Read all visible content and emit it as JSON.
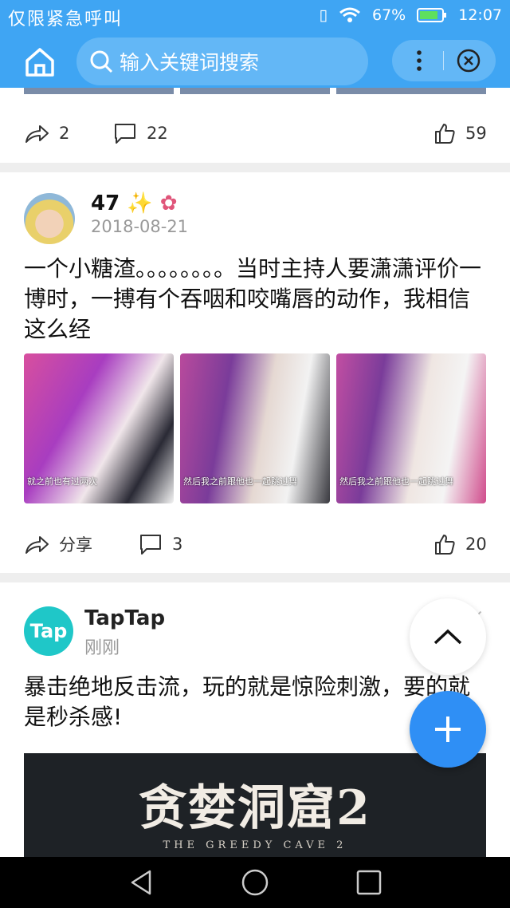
{
  "status_bar": {
    "carrier": "仅限紧急呼叫",
    "battery": "67%",
    "time": "12:07"
  },
  "header": {
    "search_placeholder": "输入关键词搜索"
  },
  "post1": {
    "share_count": "2",
    "comment_count": "22",
    "like_count": "59"
  },
  "post2": {
    "author": "47",
    "date": "2018-08-21",
    "text": "一个小糖渣。。。。。。。。当时主持人要潇潇评价一博时，一搏有个吞咽和咬嘴唇的动作，我相信这么经",
    "images": [
      {
        "caption": "就之前也有过两次"
      },
      {
        "caption": "然后我之前跟他也一起跳过舞"
      },
      {
        "caption": "然后我之前跟他也一起跳过舞"
      }
    ],
    "share_label": "分享",
    "comment_count": "3",
    "like_count": "20"
  },
  "ad": {
    "logo_text": "Tap",
    "name": "TapTap",
    "time": "刚刚",
    "text": "暴击绝地反击流，玩的就是惊险刺激，要的就是秒杀感!",
    "banner_title": "贪婪洞窟2",
    "banner_subtitle": "THE GREEDY CAVE 2"
  },
  "colors": {
    "header": "#3fa5f3",
    "fab": "#2f8ff5",
    "tap_logo": "#1fc7c8"
  }
}
